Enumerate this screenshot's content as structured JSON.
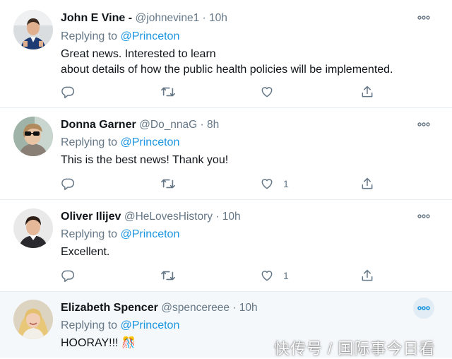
{
  "tweets": [
    {
      "name": "John E Vine -",
      "meta": "@johnevine1 · 10h",
      "replying_prefix": "Replying to",
      "replying_handle": "@Princeton",
      "body_lines": [
        "Great news.  Interested to learn",
        "about details of how the public health policies will be implemented."
      ],
      "reply_count": "",
      "retweet_count": "",
      "like_count": ""
    },
    {
      "name": "Donna Garner",
      "meta": "@Do_nnaG · 8h",
      "replying_prefix": "Replying to",
      "replying_handle": "@Princeton",
      "body_lines": [
        "This is the best news! Thank you!"
      ],
      "reply_count": "",
      "retweet_count": "",
      "like_count": "1"
    },
    {
      "name": "Oliver Ilijev",
      "meta": "@HeLovesHistory · 10h",
      "replying_prefix": "Replying to",
      "replying_handle": "@Princeton",
      "body_lines": [
        "Excellent."
      ],
      "reply_count": "",
      "retweet_count": "",
      "like_count": "1"
    },
    {
      "name": "Elizabeth Spencer",
      "meta": "@spencereee · 10h",
      "replying_prefix": "Replying to",
      "replying_handle": "@Princeton",
      "body_lines": [
        "HOORAY!!! 🎊"
      ]
    }
  ],
  "icons": {
    "reply": "reply-icon",
    "retweet": "retweet-icon",
    "like": "heart-icon",
    "share": "share-icon",
    "more": "more-icon"
  },
  "colors": {
    "accent": "#1b95e0",
    "secondary_text": "#657786",
    "icon": "#657786",
    "divider": "#e6ecf0"
  },
  "watermark": "快传号 / 国际事今日看"
}
